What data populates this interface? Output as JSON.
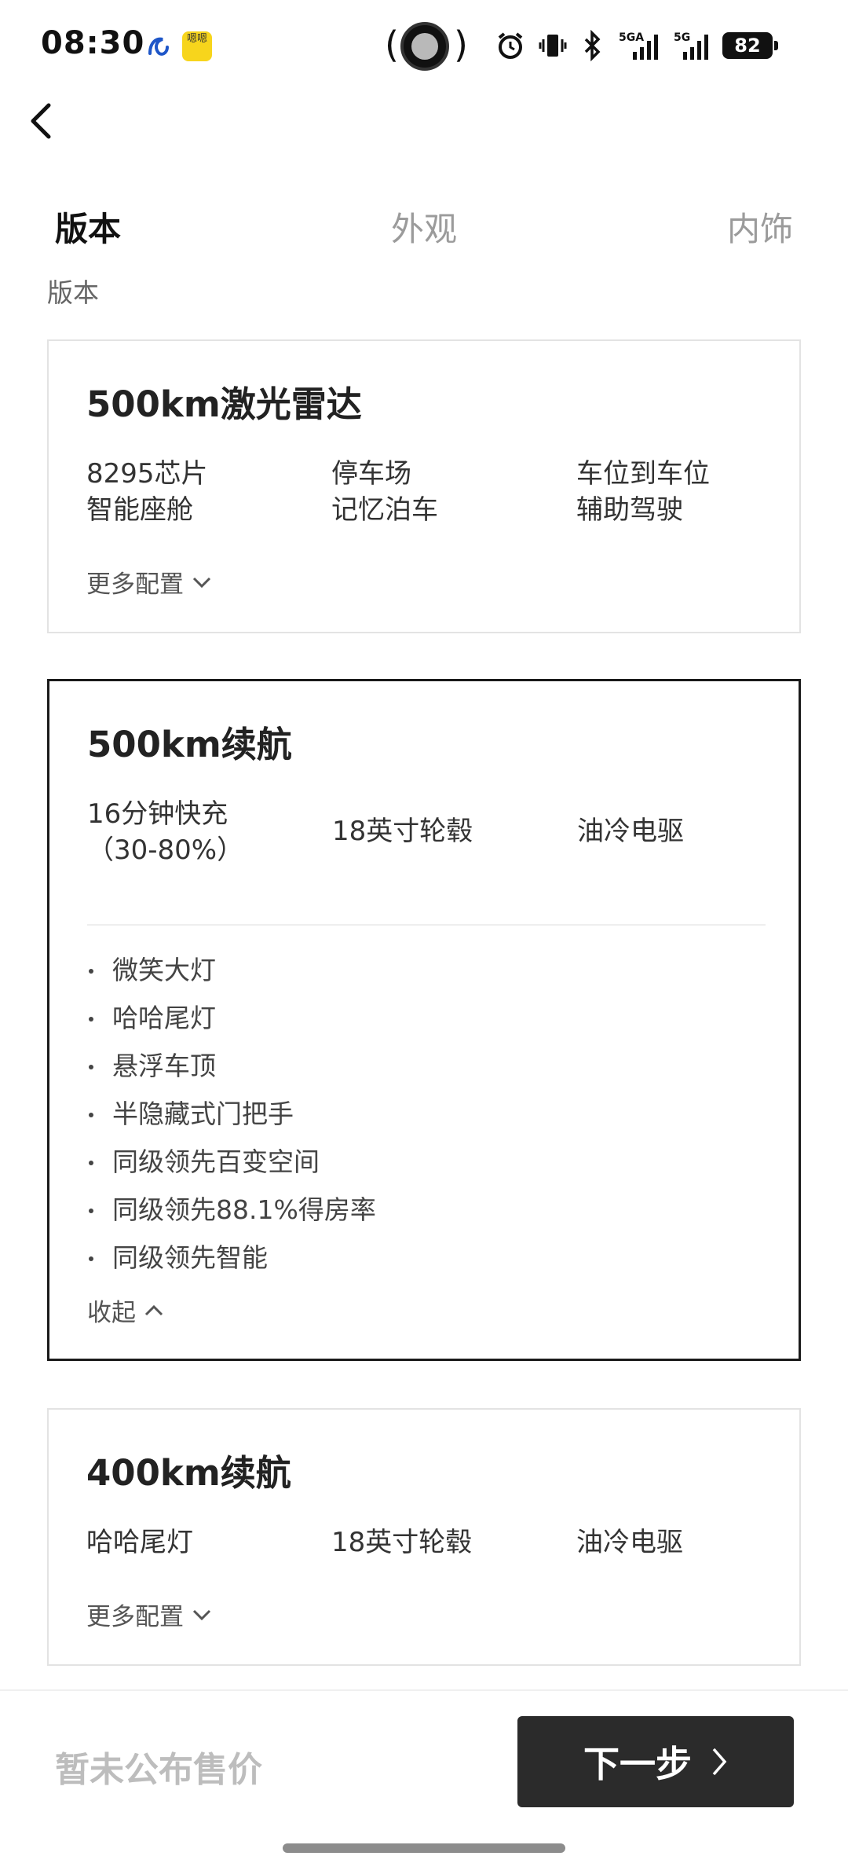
{
  "status_bar": {
    "time": "08:30",
    "app_badge_text": "嗯嗯",
    "battery": "82",
    "signal1_label": "5GA",
    "signal2_label": "5G"
  },
  "tabs": [
    {
      "label": "版本",
      "active": true
    },
    {
      "label": "外观",
      "active": false
    },
    {
      "label": "内饰",
      "active": false
    }
  ],
  "section_label": "版本",
  "cards": [
    {
      "title": "500km激光雷达",
      "features": [
        "8295芯片\n智能座舱",
        "停车场\n记忆泊车",
        "车位到车位\n辅助驾驶"
      ],
      "more_label": "更多配置"
    },
    {
      "title": "500km续航",
      "features": [
        "16分钟快充\n（30-80%）",
        "18英寸轮毂",
        "油冷电驱"
      ],
      "bullets": [
        "微笑大灯",
        "哈哈尾灯",
        "悬浮车顶",
        "半隐藏式门把手",
        "同级领先百变空间",
        "同级领先88.1%得房率",
        "同级领先智能"
      ],
      "collapse_label": "收起"
    },
    {
      "title": "400km续航",
      "features": [
        "哈哈尾灯",
        "18英寸轮毂",
        "油冷电驱"
      ],
      "more_label": "更多配置"
    }
  ],
  "bottom": {
    "price_text": "暂未公布售价",
    "next_label": "下一步"
  }
}
